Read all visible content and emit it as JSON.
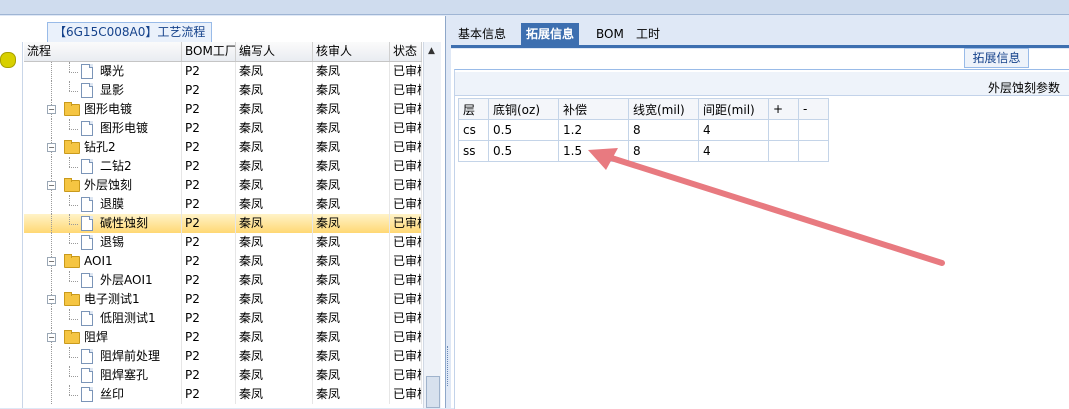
{
  "left_panel": {
    "title": "【6G15C008A0】工艺流程",
    "columns": [
      "流程",
      "BOM工厂",
      "编写人",
      "核审人",
      "状态"
    ],
    "rows": [
      {
        "name": "曝光",
        "type": "file",
        "depth": 2,
        "bom": "P2",
        "writer": "秦凤",
        "reviewer": "秦凤",
        "status": "已审核"
      },
      {
        "name": "显影",
        "type": "file",
        "depth": 2,
        "bom": "P2",
        "writer": "秦凤",
        "reviewer": "秦凤",
        "status": "已审核"
      },
      {
        "name": "图形电镀",
        "type": "folder",
        "depth": 1,
        "bom": "P2",
        "writer": "秦凤",
        "reviewer": "秦凤",
        "status": "已审核"
      },
      {
        "name": "图形电镀",
        "type": "file",
        "depth": 2,
        "bom": "P2",
        "writer": "秦凤",
        "reviewer": "秦凤",
        "status": "已审核"
      },
      {
        "name": "钻孔2",
        "type": "folder",
        "depth": 1,
        "bom": "P2",
        "writer": "秦凤",
        "reviewer": "秦凤",
        "status": "已审核"
      },
      {
        "name": "二钻2",
        "type": "file",
        "depth": 2,
        "bom": "P2",
        "writer": "秦凤",
        "reviewer": "秦凤",
        "status": "已审核"
      },
      {
        "name": "外层蚀刻",
        "type": "folder",
        "depth": 1,
        "bom": "P2",
        "writer": "秦凤",
        "reviewer": "秦凤",
        "status": "已审核"
      },
      {
        "name": "退膜",
        "type": "file",
        "depth": 2,
        "bom": "P2",
        "writer": "秦凤",
        "reviewer": "秦凤",
        "status": "已审核"
      },
      {
        "name": "碱性蚀刻",
        "type": "file",
        "depth": 2,
        "bom": "P2",
        "writer": "秦凤",
        "reviewer": "秦凤",
        "status": "已审核",
        "selected": true
      },
      {
        "name": "退锡",
        "type": "file",
        "depth": 2,
        "bom": "P2",
        "writer": "秦凤",
        "reviewer": "秦凤",
        "status": "已审核"
      },
      {
        "name": "AOI1",
        "type": "folder",
        "depth": 1,
        "bom": "P2",
        "writer": "秦凤",
        "reviewer": "秦凤",
        "status": "已审核"
      },
      {
        "name": "外层AOI1",
        "type": "file",
        "depth": 2,
        "bom": "P2",
        "writer": "秦凤",
        "reviewer": "秦凤",
        "status": "已审核"
      },
      {
        "name": "电子测试1",
        "type": "folder",
        "depth": 1,
        "bom": "P2",
        "writer": "秦凤",
        "reviewer": "秦凤",
        "status": "已审核"
      },
      {
        "name": "低阻测试1",
        "type": "file",
        "depth": 2,
        "bom": "P2",
        "writer": "秦凤",
        "reviewer": "秦凤",
        "status": "已审核"
      },
      {
        "name": "阻焊",
        "type": "folder",
        "depth": 1,
        "bom": "P2",
        "writer": "秦凤",
        "reviewer": "秦凤",
        "status": "已审核"
      },
      {
        "name": "阻焊前处理",
        "type": "file",
        "depth": 2,
        "bom": "P2",
        "writer": "秦凤",
        "reviewer": "秦凤",
        "status": "已审核"
      },
      {
        "name": "阻焊塞孔",
        "type": "file",
        "depth": 2,
        "bom": "P2",
        "writer": "秦凤",
        "reviewer": "秦凤",
        "status": "已审核"
      },
      {
        "name": "丝印",
        "type": "file",
        "depth": 2,
        "bom": "P2",
        "writer": "秦凤",
        "reviewer": "秦凤",
        "status": "已审核"
      }
    ]
  },
  "right_panel": {
    "tabs": [
      {
        "label": "基本信息",
        "active": false
      },
      {
        "label": "拓展信息",
        "active": true
      },
      {
        "label": "BOM",
        "active": false
      },
      {
        "label": "工时",
        "active": false
      }
    ],
    "ext_title": "拓展信息",
    "section_title": "外层蚀刻参数",
    "table": {
      "headers": [
        "层",
        "底铜(oz)",
        "补偿",
        "线宽(mil)",
        "间距(mil)",
        "+",
        "-"
      ],
      "rows": [
        [
          "cs",
          "0.5",
          "1.2",
          "8",
          "4",
          "",
          ""
        ],
        [
          "ss",
          "0.5",
          "1.5",
          "8",
          "4",
          "",
          ""
        ]
      ]
    }
  },
  "annotation": {
    "type": "arrow",
    "color": "#e87a80",
    "points_to": "补偿 value 1.5 in row ss"
  }
}
